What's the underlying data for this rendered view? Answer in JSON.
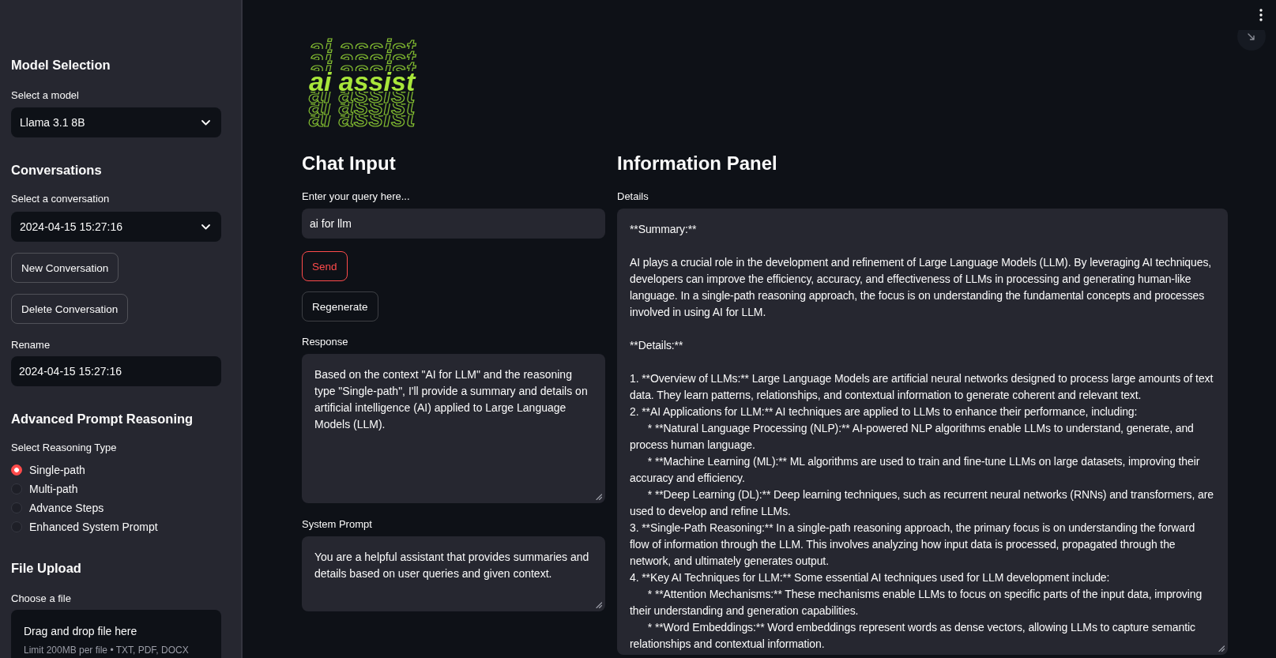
{
  "sidebar": {
    "model_selection": {
      "heading": "Model Selection",
      "label": "Select a model",
      "value": "Llama 3.1 8B"
    },
    "conversations": {
      "heading": "Conversations",
      "label": "Select a conversation",
      "value": "2024-04-15 15:27:16",
      "buttons": [
        "New Conversation",
        "Delete Conversation"
      ],
      "rename_label": "Rename",
      "rename_value": "2024-04-15 15:27:16"
    },
    "reasoning": {
      "heading": "Advanced Prompt Reasoning",
      "label": "Select Reasoning Type",
      "options": [
        {
          "label": "Single-path",
          "selected": true
        },
        {
          "label": "Multi-path",
          "selected": false
        },
        {
          "label": "Advance Steps",
          "selected": false
        },
        {
          "label": "Enhanced System Prompt",
          "selected": false
        }
      ]
    },
    "file_upload": {
      "heading": "File Upload",
      "label": "Choose a file",
      "dropzone_title": "Drag and drop file here",
      "dropzone_hint": "Limit 200MB per file • TXT, PDF, DOCX"
    }
  },
  "logo": {
    "text": "ai assist"
  },
  "chat_input": {
    "heading": "Chat Input",
    "query_label": "Enter your query here...",
    "query_value": "ai for llm",
    "buttons": [
      {
        "label": "Send",
        "focused": true
      },
      {
        "label": "Regenerate",
        "focused": false
      }
    ],
    "response_label": "Response",
    "response_value": "Based on the context \"AI for LLM\" and the reasoning type \"Single-path\", I'll provide a summary and details on artificial intelligence (AI) applied to Large Language Models (LLM).",
    "system_prompt_label": "System Prompt",
    "system_prompt_value": "You are a helpful assistant that provides summaries and details based on user queries and given context."
  },
  "information_panel": {
    "heading": "Information Panel",
    "details_label": "Details",
    "details_value": "**Summary:**\n\nAI plays a crucial role in the development and refinement of Large Language Models (LLM). By leveraging AI techniques, developers can improve the efficiency, accuracy, and effectiveness of LLMs in processing and generating human-like language. In a single-path reasoning approach, the focus is on understanding the fundamental concepts and processes involved in using AI for LLM.\n\n**Details:**\n\n1. **Overview of LLMs:** Large Language Models are artificial neural networks designed to process large amounts of text data. They learn patterns, relationships, and contextual information to generate coherent and relevant text.\n2. **AI Applications for LLM:** AI techniques are applied to LLMs to enhance their performance, including:\n\t* **Natural Language Processing (NLP):** AI-powered NLP algorithms enable LLMs to understand, generate, and process human language.\n\t* **Machine Learning (ML):** ML algorithms are used to train and fine-tune LLMs on large datasets, improving their accuracy and efficiency.\n\t* **Deep Learning (DL):** Deep learning techniques, such as recurrent neural networks (RNNs) and transformers, are used to develop and refine LLMs.\n3. **Single-Path Reasoning:** In a single-path reasoning approach, the primary focus is on understanding the forward flow of information through the LLM. This involves analyzing how input data is processed, propagated through the network, and ultimately generates output.\n4. **Key AI Techniques for LLM:** Some essential AI techniques used for LLM development include:\n\t* **Attention Mechanisms:** These mechanisms enable LLMs to focus on specific parts of the input data, improving their understanding and generation capabilities.\n\t* **Word Embeddings:** Word embeddings represent words as dense vectors, allowing LLMs to capture semantic relationships and contextual information."
  }
}
